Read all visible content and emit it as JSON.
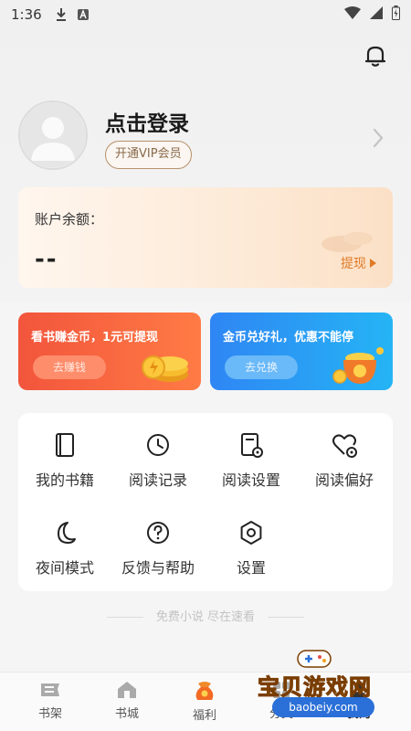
{
  "status_bar": {
    "time": "1:36"
  },
  "profile": {
    "login_text": "点击登录",
    "vip_label": "开通VIP会员"
  },
  "balance": {
    "label": "账户余额：",
    "value": "--",
    "withdraw_label": "提现"
  },
  "promos": [
    {
      "title": "看书赚金币，1元可提现",
      "button": "去赚钱",
      "color": "#f2553c"
    },
    {
      "title": "金币兑好礼，优惠不能停",
      "button": "去兑换",
      "color": "#2f86f4"
    }
  ],
  "menu": {
    "items": [
      {
        "label": "我的书籍",
        "icon": "book-icon"
      },
      {
        "label": "阅读记录",
        "icon": "clock-icon"
      },
      {
        "label": "阅读设置",
        "icon": "reading-settings-icon"
      },
      {
        "label": "阅读偏好",
        "icon": "heart-settings-icon"
      },
      {
        "label": "夜间模式",
        "icon": "moon-icon"
      },
      {
        "label": "反馈与帮助",
        "icon": "question-icon"
      },
      {
        "label": "设置",
        "icon": "hexagon-settings-icon"
      }
    ]
  },
  "slogan": "免费小说 尽在速看",
  "bottom_nav": {
    "items": [
      {
        "label": "书架",
        "icon": "bookshelf-icon"
      },
      {
        "label": "书城",
        "icon": "bookstore-icon"
      },
      {
        "label": "福利",
        "icon": "gift-bag-icon"
      },
      {
        "label": "分类",
        "icon": "category-icon"
      },
      {
        "label": "我的",
        "icon": "profile-icon"
      }
    ],
    "active_index": 4
  },
  "watermark": {
    "text": "宝贝游戏网",
    "url": "baobeiy.com"
  },
  "colors": {
    "accent": "#e07a26",
    "vip_border": "#b8916b"
  }
}
